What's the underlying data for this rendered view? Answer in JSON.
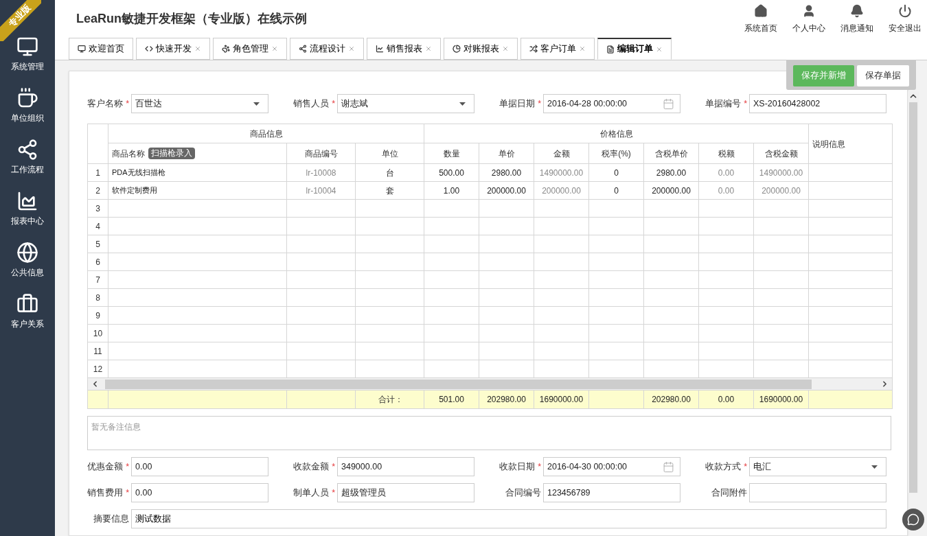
{
  "badge": "专业版",
  "sidebar": {
    "items": [
      {
        "label": "系统管理"
      },
      {
        "label": "单位组织"
      },
      {
        "label": "工作流程"
      },
      {
        "label": "报表中心"
      },
      {
        "label": "公共信息"
      },
      {
        "label": "客户关系"
      }
    ]
  },
  "header": {
    "title": "LeaRun敏捷开发框架（专业版）在线示例",
    "actions": [
      {
        "label": "系统首页"
      },
      {
        "label": "个人中心"
      },
      {
        "label": "消息通知"
      },
      {
        "label": "安全退出"
      }
    ]
  },
  "tabs": [
    {
      "label": "欢迎首页",
      "selected": false,
      "closable": false
    },
    {
      "label": "快速开发",
      "selected": false,
      "closable": true
    },
    {
      "label": "角色管理",
      "selected": false,
      "closable": true
    },
    {
      "label": "流程设计",
      "selected": false,
      "closable": true
    },
    {
      "label": "销售报表",
      "selected": false,
      "closable": true
    },
    {
      "label": "对账报表",
      "selected": false,
      "closable": true
    },
    {
      "label": "客户订单",
      "selected": false,
      "closable": true
    },
    {
      "label": "编辑订单",
      "selected": true,
      "closable": true
    }
  ],
  "toolbar": [
    {
      "label": "保存并新增",
      "kind": "primary"
    },
    {
      "label": "保存单据",
      "kind": "default"
    }
  ],
  "top_fields": [
    {
      "label": "客户名称",
      "required_mark": "*",
      "value": "百世达",
      "kind": "select"
    },
    {
      "label": "销售人员",
      "required_mark": "*",
      "value": "谢志斌",
      "kind": "select"
    },
    {
      "label": "单据日期",
      "required_mark": "*",
      "value": "2016-04-28 00:00:00",
      "kind": "date"
    },
    {
      "label": "单据编号",
      "required_mark": "*",
      "value": "XS-20160428002",
      "kind": "text"
    }
  ],
  "table": {
    "groups": [
      {
        "label": "商品信息"
      },
      {
        "label": "价格信息"
      }
    ],
    "note_column": "说明信息",
    "scan_button": "扫描枪录入",
    "columns": [
      {
        "label": "商品名称",
        "muted": false
      },
      {
        "label": "商品编号",
        "muted": true
      },
      {
        "label": "单位",
        "muted": false
      },
      {
        "label": "数量",
        "muted": false
      },
      {
        "label": "单价",
        "muted": false
      },
      {
        "label": "金额",
        "muted": true
      },
      {
        "label": "税率(%)",
        "muted": false
      },
      {
        "label": "含税单价",
        "muted": false
      },
      {
        "label": "税额",
        "muted": true
      },
      {
        "label": "含税金额",
        "muted": true
      }
    ],
    "rows": [
      {
        "number": "1",
        "cells": [
          "PDA无线扫描枪",
          "lr-10008",
          "台",
          "500.00",
          "2980.00",
          "1490000.00",
          "0",
          "2980.00",
          "0.00",
          "1490000.00"
        ]
      },
      {
        "number": "2",
        "cells": [
          "软件定制费用",
          "lr-10004",
          "套",
          "1.00",
          "200000.00",
          "200000.00",
          "0",
          "200000.00",
          "0.00",
          "200000.00"
        ]
      },
      {
        "number": "3"
      },
      {
        "number": "4"
      },
      {
        "number": "5"
      },
      {
        "number": "6"
      },
      {
        "number": "7"
      },
      {
        "number": "8"
      },
      {
        "number": "9"
      },
      {
        "number": "10"
      },
      {
        "number": "11"
      },
      {
        "number": "12"
      }
    ],
    "totals": {
      "label": "合计：",
      "values": [
        {
          "kind": "value",
          "text": "501.00"
        },
        {
          "kind": "value",
          "text": "202980.00"
        },
        {
          "kind": "value",
          "text": "1690000.00"
        },
        {
          "kind": "empty"
        },
        {
          "kind": "value",
          "text": "202980.00"
        },
        {
          "kind": "value",
          "text": "0.00"
        },
        {
          "kind": "value",
          "text": "1690000.00"
        }
      ]
    }
  },
  "remark": {
    "placeholder": "暂无备注信息"
  },
  "bottom_fields": [
    {
      "label": "优惠金额",
      "required_mark": "*",
      "value": "0.00",
      "kind": "text"
    },
    {
      "label": "收款金额",
      "required_mark": "*",
      "value": "349000.00",
      "kind": "text"
    },
    {
      "label": "收款日期",
      "required_mark": "*",
      "value": "2016-04-30 00:00:00",
      "kind": "date"
    },
    {
      "label": "收款方式",
      "required_mark": "*",
      "value": "电汇",
      "kind": "select"
    },
    {
      "label": "销售费用",
      "required_mark": "*",
      "value": "0.00",
      "kind": "text"
    },
    {
      "label": "制单人员",
      "required_mark": "*",
      "value": "超级管理员",
      "kind": "text"
    },
    {
      "label": "合同编号",
      "value": "123456789",
      "kind": "text"
    },
    {
      "label": "合同附件",
      "kind": "text"
    }
  ],
  "summary": {
    "label": "摘要信息",
    "value": "测试数据"
  }
}
